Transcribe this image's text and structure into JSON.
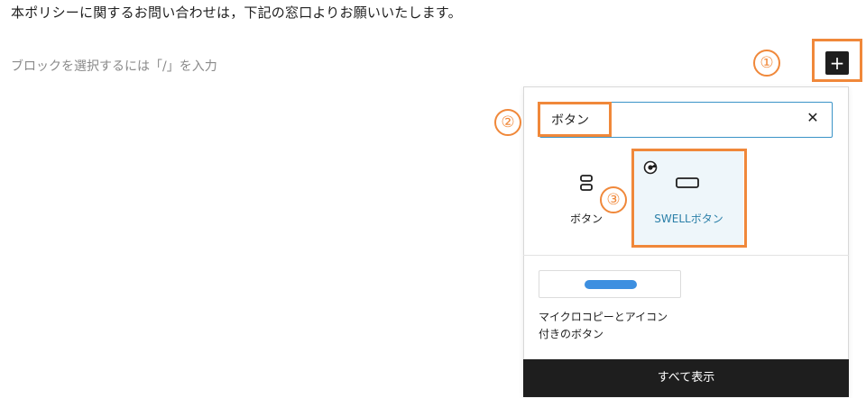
{
  "editor": {
    "paragraph_text": "本ポリシーに関するお問い合わせは，下記の窓口よりお願いいたします。",
    "block_placeholder": "ブロックを選択するには「/」を入力"
  },
  "steps": {
    "one": "①",
    "two": "②",
    "three": "③"
  },
  "inserter": {
    "toggle_icon": "plus-icon",
    "toggle_glyph": "+",
    "search_value": "ボタン",
    "clear_glyph": "✕",
    "results": [
      {
        "label": "ボタン",
        "icon": "buttons-icon"
      },
      {
        "label": "SWELLボタン",
        "icon": "swell-button-icon",
        "selected": true
      }
    ],
    "pattern": {
      "title_line1": "マイクロコピーとアイコン",
      "title_line2": "付きのボタン"
    },
    "show_all_label": "すべて表示"
  },
  "colors": {
    "accent_orange": "#f0883a",
    "focus_blue": "#3a93c7",
    "swell_label": "#2a7fa8",
    "selected_bg": "#eef6fa",
    "dark": "#1e1e1e"
  }
}
